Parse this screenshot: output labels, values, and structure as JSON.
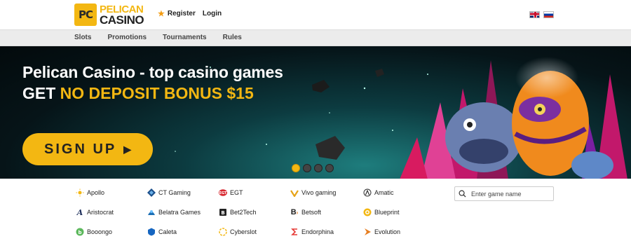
{
  "header": {
    "logo": {
      "badge": "PC",
      "line1": "PELICAN",
      "line2": "CASINO"
    },
    "register_label": "Register",
    "login_label": "Login",
    "languages": [
      "english-flag",
      "russian-flag"
    ]
  },
  "nav": {
    "items": [
      {
        "label": "Slots"
      },
      {
        "label": "Promotions"
      },
      {
        "label": "Tournaments"
      },
      {
        "label": "Rules"
      }
    ]
  },
  "banner": {
    "title": "Pelican Casino - top casino games",
    "subtitle_prefix": "GET ",
    "subtitle_highlight": "NO DEPOSIT BONUS $15",
    "signup_label": "SIGN UP",
    "slides": 4,
    "active_slide": 1
  },
  "providers": [
    {
      "label": "Apollo",
      "icon": "sun-icon",
      "color": "#f3b712"
    },
    {
      "label": "CT Gaming",
      "icon": "ct-gaming-icon",
      "color": "#1a4f8b"
    },
    {
      "label": "EGT",
      "icon": "egt-icon",
      "color": "#d7262e"
    },
    {
      "label": "Vivo gaming",
      "icon": "vivo-icon",
      "color": "#e6a317"
    },
    {
      "label": "Amatic",
      "icon": "amatic-icon",
      "color": "#333333"
    },
    {
      "label": "Aristocrat",
      "icon": "aristocrat-icon",
      "color": "#1c2d5a"
    },
    {
      "label": "Belatra Games",
      "icon": "belatra-icon",
      "color": "#1b6fb5"
    },
    {
      "label": "Bet2Tech",
      "icon": "bet2tech-icon",
      "color": "#222222"
    },
    {
      "label": "Betsoft",
      "icon": "betsoft-icon",
      "color": "#e67e22"
    },
    {
      "label": "Blueprint",
      "icon": "blueprint-icon",
      "color": "#f3b712"
    },
    {
      "label": "Booongo",
      "icon": "booongo-icon",
      "color": "#5cb85c"
    },
    {
      "label": "Caleta",
      "icon": "caleta-icon",
      "color": "#1565c0"
    },
    {
      "label": "Cyberslot",
      "icon": "cyberslot-icon",
      "color": "#f3b712"
    },
    {
      "label": "Endorphina",
      "icon": "endorphina-icon",
      "color": "#e53935"
    },
    {
      "label": "Evolution",
      "icon": "evolution-icon",
      "color": "#e67e22"
    }
  ],
  "search": {
    "placeholder": "Enter game name",
    "value": ""
  }
}
